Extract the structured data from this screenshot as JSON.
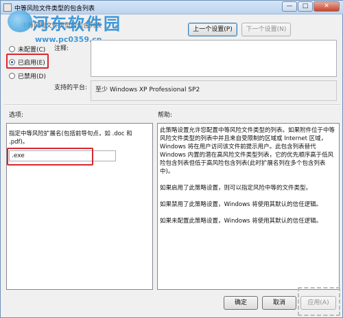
{
  "window": {
    "title": "中等风险文件类型的包含列表",
    "policy_name": "中等风险文件类型的包含列表",
    "controls": {
      "minimize": "—",
      "maximize": "□",
      "close": "✕"
    }
  },
  "watermark": {
    "name": "河东软件园",
    "url": "www.pc0359.cn"
  },
  "nav": {
    "prev_setting": "上一个设置(P)",
    "next_setting": "下一个设置(N)"
  },
  "state": {
    "not_configured": "未配置(C)",
    "enabled": "已启用(E)",
    "disabled": "已禁用(D)",
    "selected": "enabled"
  },
  "comment": {
    "label": "注释:",
    "value": ""
  },
  "platform": {
    "label": "支持的平台:",
    "value": "至少 Windows XP Professional SP2"
  },
  "options": {
    "heading": "选项:",
    "description": "指定中等风险扩展名(包括前导句点，如 .doc 和 .pdf)。",
    "extension_value": ".exe"
  },
  "help": {
    "heading": "帮助:",
    "paragraphs": [
      "此策略设置允许您配置中等风险文件类型的列表。如果附件位于中等风险文件类型的列表中并且来自受限制的区域或 Internet 区域，Windows 将在用户访问该文件前提示用户。此包含列表替代 Windows 内置的潜在高风险文件类型列表，它的优先顺序高于低风险包含列表但低于高风险包含列表(此时扩展名列在多个包含列表中)。",
      "如果启用了此策略设置，则可以指定风险中等的文件类型。",
      "如果禁用了此策略设置，Windows 将使用其默认的信任逻辑。",
      "如果未配置此策略设置，Windows 将使用其默认的信任逻辑。"
    ]
  },
  "footer": {
    "ok": "确定",
    "cancel": "取消",
    "apply": "应用(A)"
  },
  "colors": {
    "highlight": "#d9262f",
    "watermark": "#2a8fd9"
  }
}
